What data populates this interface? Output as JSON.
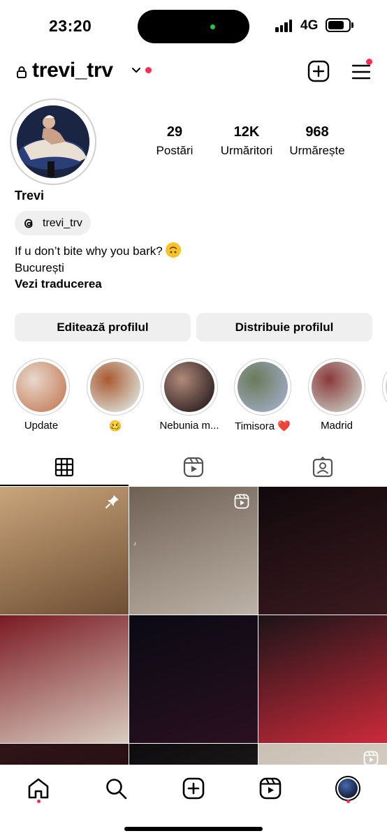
{
  "status_bar": {
    "time": "23:20",
    "network": "4G",
    "battery_level": 0.8
  },
  "header": {
    "username": "trevi_trv",
    "has_notification_dot": true
  },
  "profile": {
    "stats": [
      {
        "value": "29",
        "label": "Postări"
      },
      {
        "value": "12K",
        "label": "Urmăritori"
      },
      {
        "value": "968",
        "label": "Urmărește"
      }
    ],
    "display_name": "Trevi",
    "threads_handle": "trevi_trv",
    "bio_line1": "If u don’t bite why you bark?",
    "bio_line2": "București",
    "bio_translate": "Vezi traducerea"
  },
  "buttons": {
    "edit": "Editează profilul",
    "share": "Distribuie profilul"
  },
  "highlights": [
    {
      "label": "Update",
      "color_a": "#c98a6a",
      "color_b": "#e8d8cc"
    },
    {
      "label": "🥴",
      "color_a": "#d8d2c8",
      "color_b": "#a85a30"
    },
    {
      "label": "Nebunia m...",
      "color_a": "#3a2a2a",
      "color_b": "#b08a7a"
    },
    {
      "label": "Timisora ❤️",
      "color_a": "#9aa6b8",
      "color_b": "#6a7a5a"
    },
    {
      "label": "Madrid",
      "color_a": "#c0b8b0",
      "color_b": "#8a3a3a"
    }
  ],
  "tabs": [
    "grid-icon",
    "reels-icon",
    "tagged-icon"
  ],
  "posts": [
    {
      "kind": "pinned",
      "color_a": "#6e4e34",
      "color_b": "#c9a57b"
    },
    {
      "kind": "reel-tiktok",
      "color_a": "#bdb2a7",
      "color_b": "#6f6054"
    },
    {
      "kind": "photo",
      "color_a": "#3a1a1f",
      "color_b": "#11090c"
    },
    {
      "kind": "photo",
      "color_a": "#d9ccc0",
      "color_b": "#7a1a22"
    },
    {
      "kind": "photo",
      "color_a": "#2a1020",
      "color_b": "#0a0a14"
    },
    {
      "kind": "photo",
      "color_a": "#cc2a3a",
      "color_b": "#1a1418"
    },
    {
      "kind": "photo",
      "color_a": "#1a0a0e",
      "color_b": "#301418"
    },
    {
      "kind": "photo",
      "color_a": "#2c2628",
      "color_b": "#0e0c0e"
    },
    {
      "kind": "reel",
      "color_a": "#e6dfd6",
      "color_b": "#c9bfb3"
    }
  ],
  "bottom_nav": [
    "home-icon",
    "search-icon",
    "create-icon",
    "reels-icon",
    "profile-avatar"
  ]
}
